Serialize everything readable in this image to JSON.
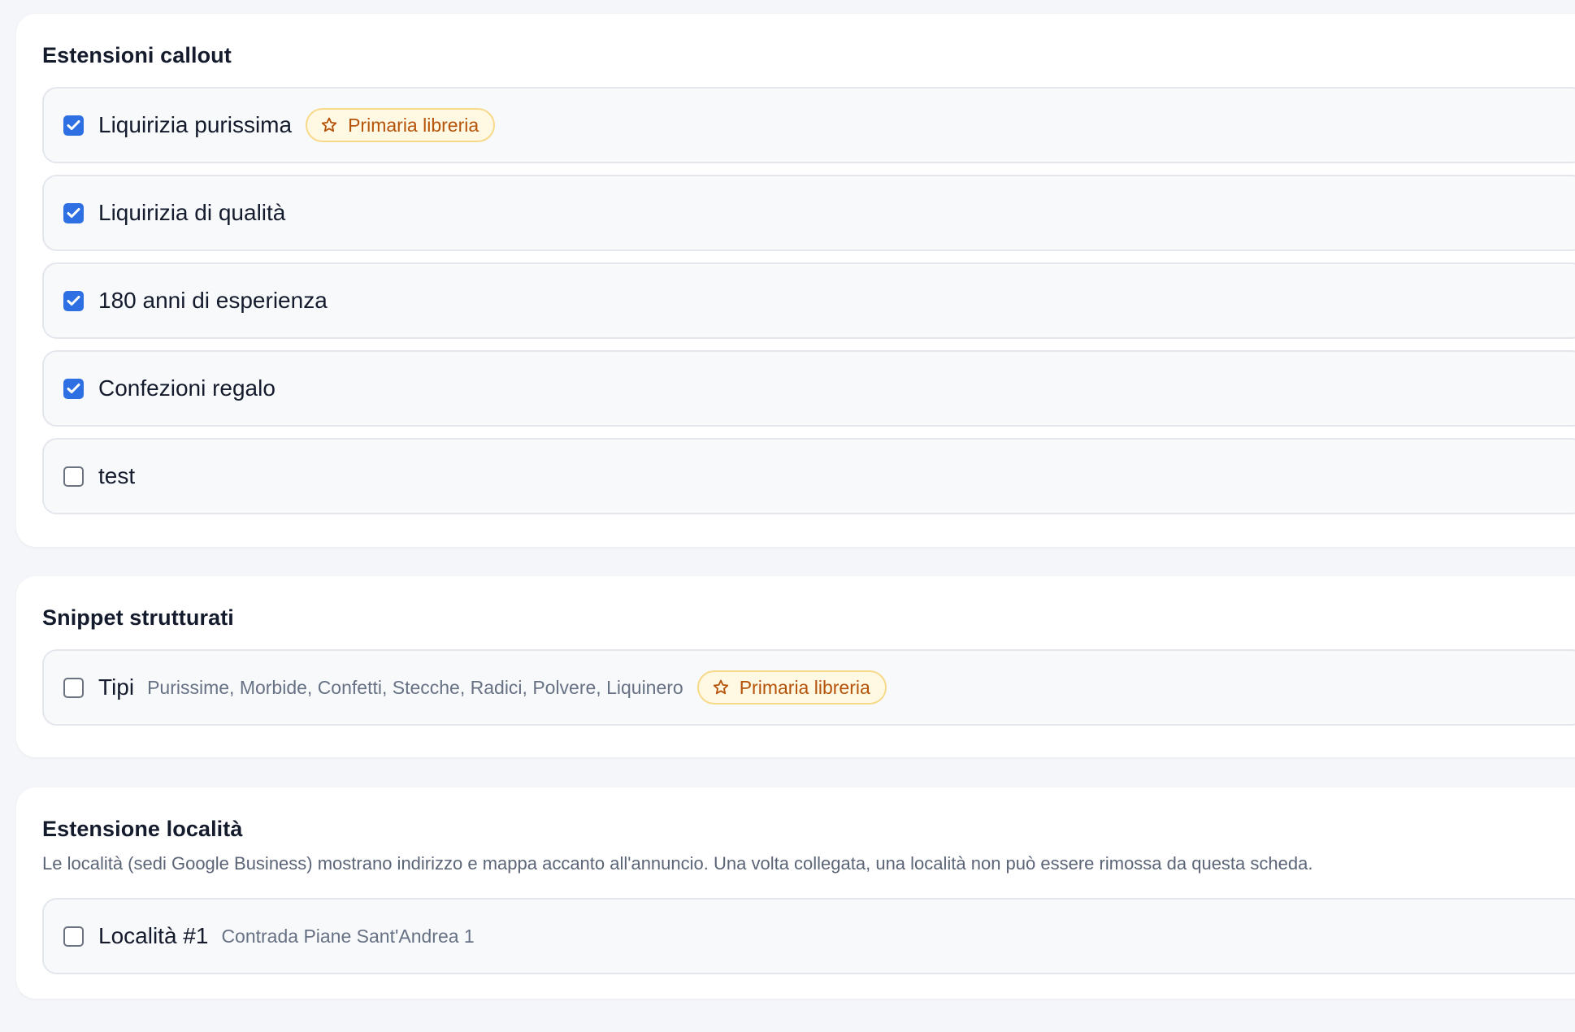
{
  "callouts": {
    "title": "Estensioni callout",
    "items": [
      {
        "label": "Liquirizia purissima",
        "checked": true,
        "badge": "Primaria libreria"
      },
      {
        "label": "Liquirizia di qualità",
        "checked": true
      },
      {
        "label": "180 anni di esperienza",
        "checked": true
      },
      {
        "label": "Confezioni regalo",
        "checked": true
      },
      {
        "label": "test",
        "checked": false
      }
    ]
  },
  "snippets": {
    "title": "Snippet strutturati",
    "items": [
      {
        "label": "Tipi",
        "values": "Purissime, Morbide, Confetti, Stecche, Radici, Polvere, Liquinero",
        "checked": false,
        "badge": "Primaria libreria"
      }
    ]
  },
  "locations": {
    "title": "Estensione località",
    "description": "Le località (sedi Google Business) mostrano indirizzo e mappa accanto all'annuncio. Una volta collegata, una località non può essere rimossa da questa scheda.",
    "items": [
      {
        "label": "Località #1",
        "address": "Contrada Piane Sant'Andrea 1",
        "checked": false
      }
    ]
  },
  "icons": {
    "checkbox_checked": "check-icon",
    "badge": "star-icon"
  },
  "colors": {
    "accent": "#2f6fe4",
    "badge_text": "#b45309",
    "badge_bg": "#fff8e3",
    "badge_border": "#f7d98a",
    "item_bg": "#f8f9fb",
    "page_bg": "#f4f6f9"
  }
}
